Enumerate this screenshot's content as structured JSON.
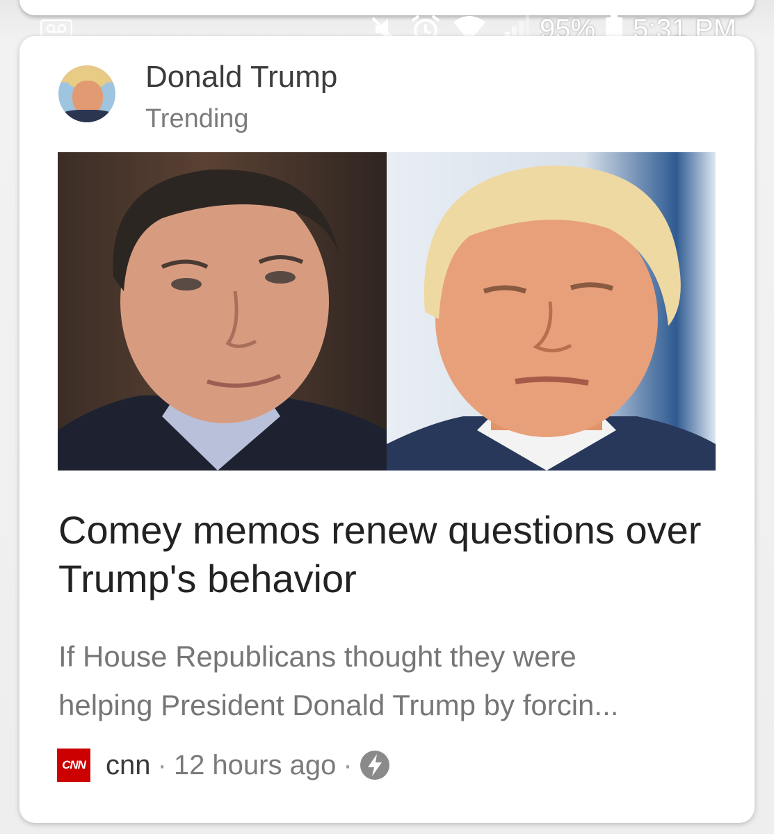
{
  "status_bar": {
    "battery_percent": "95%",
    "time": "5:31 PM",
    "icons": [
      "voicemail-icon",
      "mute-icon",
      "alarm-icon",
      "wifi-icon",
      "signal-icon",
      "battery-icon"
    ]
  },
  "card": {
    "topic_name": "Donald Trump",
    "topic_subtitle": "Trending",
    "headline": "Comey memos renew questions over Trump's behavior",
    "snippet_line1": "If House Republicans thought they were",
    "snippet_line2": "helping President Donald Trump by forcin...",
    "source_logo_text": "CNN",
    "source_name": "cnn",
    "separator": "·",
    "time_ago": "12 hours ago",
    "amp_icon": "lightning-bolt-icon"
  },
  "colors": {
    "cnn_red": "#cc0000",
    "headline_text": "#222222",
    "secondary_text": "#767676"
  }
}
